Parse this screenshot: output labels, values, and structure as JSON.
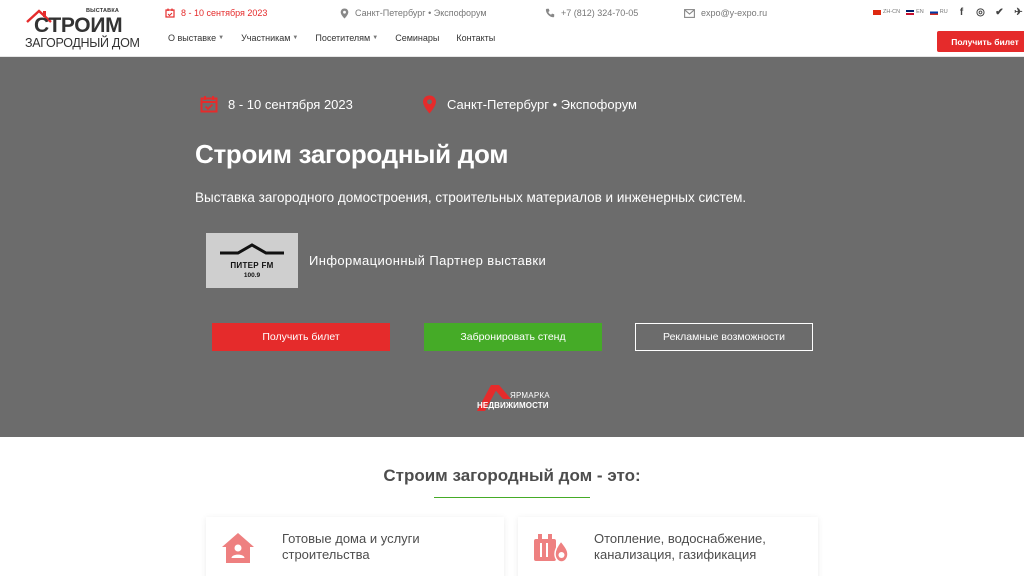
{
  "header": {
    "logo": {
      "kicker": "ВЫСТАВКА",
      "line1": "СТРОИМ",
      "line2": "ЗАГОРОДНЫЙ ДОМ"
    },
    "date": "8 - 10 сентября 2023",
    "location": "Санкт-Петербург • Экспофорум",
    "phone": "+7 (812) 324-70-05",
    "email": "expo@y-expo.ru",
    "languages": [
      {
        "code": "ZH-CN"
      },
      {
        "code": "EN"
      },
      {
        "code": "RU"
      }
    ],
    "socials": [
      {
        "icon": "facebook-icon",
        "glyph": "f"
      },
      {
        "icon": "instagram-icon",
        "glyph": "◎"
      },
      {
        "icon": "vk-icon",
        "glyph": "✔"
      },
      {
        "icon": "telegram-icon",
        "glyph": "✈"
      }
    ],
    "nav": [
      {
        "label": "О выставке",
        "dropdown": true
      },
      {
        "label": "Участникам",
        "dropdown": true
      },
      {
        "label": "Посетителям",
        "dropdown": true
      },
      {
        "label": "Семинары",
        "dropdown": false
      },
      {
        "label": "Контакты",
        "dropdown": false
      }
    ],
    "ticket_button": "Получить билет"
  },
  "hero": {
    "date": "8 - 10 сентября 2023",
    "location": "Санкт-Петербург • Экспофорум",
    "title": "Строим загородный дом",
    "subtitle": "Выставка загородного домостроения, строительных материалов и инженерных систем.",
    "partner": {
      "brand": "ПИТЕР FM",
      "frequency": "100.9",
      "text": "Информационный Партнер выставки"
    },
    "buttons": {
      "ticket": "Получить билет",
      "booth": "Забронировать стенд",
      "ads": "Рекламные возможности"
    },
    "fair_logo": {
      "line1": "ЯРМАРКА",
      "line2": "НЕДВИЖИМОСТИ"
    }
  },
  "features": {
    "title": "Строим загородный дом - это:",
    "items": [
      {
        "icon": "house-icon",
        "text": "Готовые дома и услуги строительства"
      },
      {
        "icon": "heating-icon",
        "text": "Отопление, водоснабжение, канализация, газификация"
      }
    ]
  },
  "colors": {
    "accent_red": "#e52b2b",
    "accent_green": "#45ab27",
    "hero_bg": "#6c6c6c",
    "icon_pink": "#ee8080"
  }
}
